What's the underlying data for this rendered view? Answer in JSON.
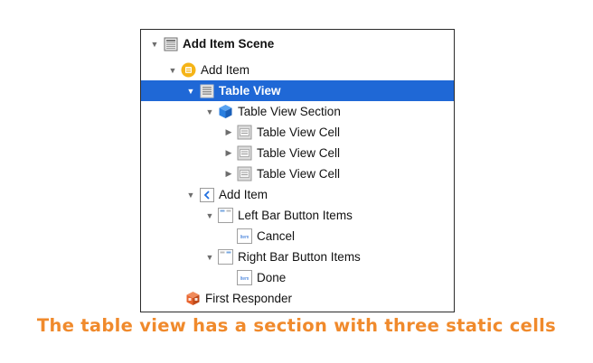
{
  "outline": {
    "scene": {
      "label": "Add Item Scene",
      "icon": "scene-icon"
    },
    "controller": {
      "label": "Add Item",
      "icon": "view-controller-icon"
    },
    "table_view": {
      "label": "Table View",
      "icon": "table-view-icon"
    },
    "section": {
      "label": "Table View Section",
      "icon": "cube-icon"
    },
    "cells": [
      {
        "label": "Table View Cell",
        "icon": "table-cell-icon"
      },
      {
        "label": "Table View Cell",
        "icon": "table-cell-icon"
      },
      {
        "label": "Table View Cell",
        "icon": "table-cell-icon"
      }
    ],
    "navigation_item": {
      "label": "Add Item",
      "icon": "back-chevron-icon"
    },
    "left_bar_items": {
      "label": "Left Bar Button Items",
      "icon": "bar-items-icon"
    },
    "cancel_item": {
      "label": "Cancel",
      "icon": "bar-button-item-icon",
      "badge": "Item"
    },
    "right_bar_items": {
      "label": "Right Bar Button Items",
      "icon": "bar-items-icon"
    },
    "done_item": {
      "label": "Done",
      "icon": "bar-button-item-icon",
      "badge": "Item"
    },
    "first_responder": {
      "label": "First Responder",
      "icon": "first-responder-icon"
    }
  },
  "caption": "The table view has a section with three static cells",
  "colors": {
    "selection": "#1f68d6",
    "caption": "#f08a2c",
    "controller_icon": "#f5b417",
    "section_icon": "#2a7fe0",
    "responder_icon": "#e8652f"
  }
}
